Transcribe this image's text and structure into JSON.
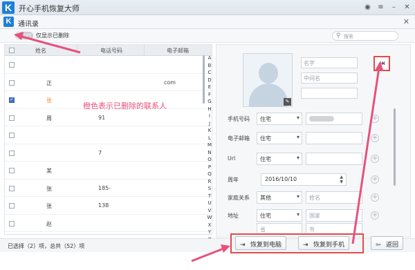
{
  "app": {
    "title": "开心手机恢复大师",
    "logo": "K"
  },
  "window": {
    "title": "通讯录",
    "logo": "K"
  },
  "toolbar": {
    "toggle_state": "OFF",
    "toggle_label": "仅显示已删除",
    "search_placeholder": "搜索",
    "search_icon": "search-icon"
  },
  "table": {
    "headers": [
      "姓名",
      "电话号码",
      "电子邮箱"
    ],
    "rows": [
      {
        "name": "",
        "phone": "",
        "email": "",
        "checked": false,
        "deleted": false
      },
      {
        "name": "正",
        "phone": "",
        "email": "com",
        "checked": false,
        "deleted": false
      },
      {
        "name": "张",
        "phone": "",
        "email": "",
        "checked": true,
        "deleted": true
      },
      {
        "name": "周",
        "phone": "91",
        "email": "",
        "checked": false,
        "deleted": false
      },
      {
        "name": "",
        "phone": "",
        "email": "",
        "checked": false,
        "deleted": false
      },
      {
        "name": "",
        "phone": "7",
        "email": "",
        "checked": false,
        "deleted": false
      },
      {
        "name": "某",
        "phone": "",
        "email": "",
        "checked": false,
        "deleted": false
      },
      {
        "name": "张",
        "phone": "185-",
        "email": "",
        "checked": false,
        "deleted": false
      },
      {
        "name": "张",
        "phone": "138",
        "email": "",
        "checked": false,
        "deleted": false
      },
      {
        "name": "赵",
        "phone": "",
        "email": "",
        "checked": false,
        "deleted": false
      }
    ]
  },
  "alphabet": [
    "A",
    "B",
    "C",
    "D",
    "E",
    "F",
    "G",
    "H",
    "I",
    "J",
    "K",
    "L",
    "M",
    "N",
    "O",
    "P",
    "Q",
    "R",
    "S",
    "T",
    "U",
    "V",
    "W",
    "X",
    "Y",
    "Z"
  ],
  "annotation": "橙色表示已删除的联系人",
  "status": {
    "text": "已选择（2）项，总共（52）项"
  },
  "detail": {
    "name_placeholder": "名字",
    "middle_placeholder": "中间名",
    "fields": [
      {
        "label": "手机号码",
        "type": "住宅",
        "value": ""
      },
      {
        "label": "电子邮箱",
        "type": "住宅",
        "value": ""
      },
      {
        "label": "Url",
        "type": "住宅",
        "value": ""
      }
    ],
    "anniversary": {
      "label": "周年",
      "date": "2016/10/10"
    },
    "family": {
      "label": "家庭关系",
      "type": "其他",
      "placeholder": "姓名"
    },
    "address": {
      "label": "地址",
      "type": "住宅",
      "placeholder": "国家",
      "extra1": "省",
      "extra2": "市"
    }
  },
  "actions": {
    "restore_pc": "恢复到电脑",
    "restore_phone": "恢复到手机",
    "back": "返回"
  },
  "colors": {
    "accent": "#1f7fd7",
    "deleted": "#f08a32",
    "annotation": "#e8507c",
    "highlight": "#e24a4a"
  }
}
